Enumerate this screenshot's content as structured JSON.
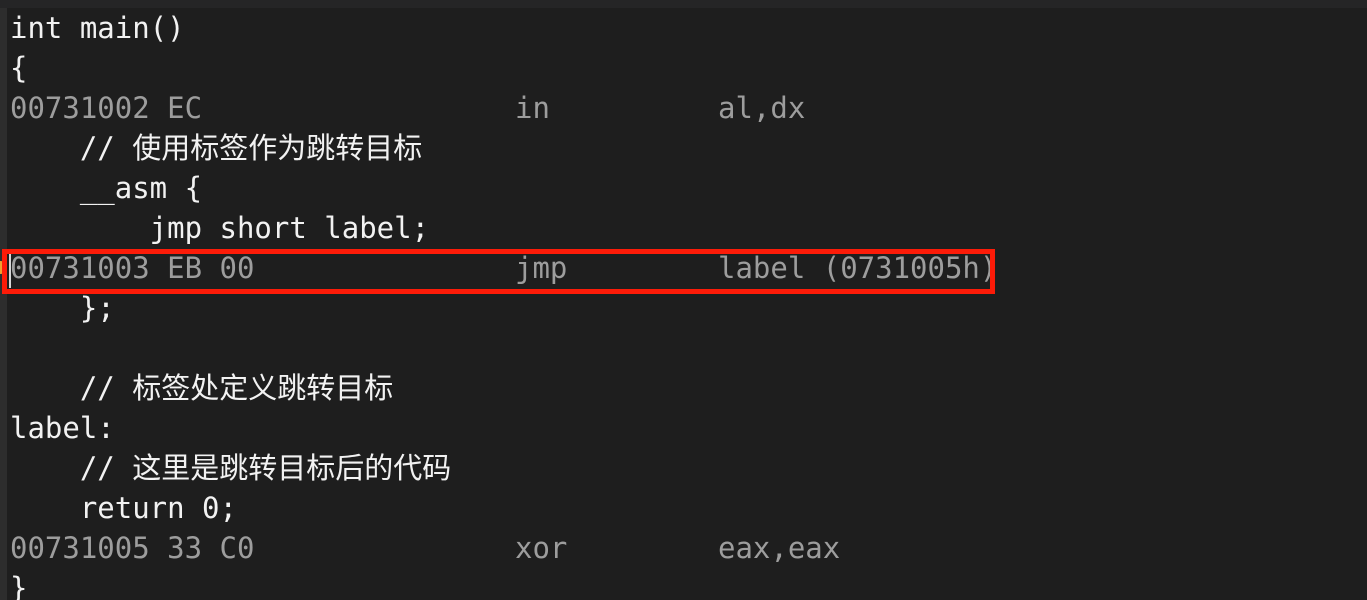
{
  "editor": {
    "background_color": "#1e1e1e",
    "gutter_color": "#2d2d2d",
    "source_text_color": "#f2f2f2",
    "disassembly_text_color": "#9d9d9d",
    "annotation_color": "#fc1b08",
    "marker_color": "#f0a030"
  },
  "lines": [
    {
      "kind": "source",
      "text": "int main()"
    },
    {
      "kind": "source",
      "text": "{"
    },
    {
      "kind": "asm",
      "address": "00731002",
      "bytes": "EC",
      "mnemonic": "in",
      "operands": "al,dx"
    },
    {
      "kind": "source",
      "text": "    // 使用标签作为跳转目标"
    },
    {
      "kind": "source",
      "text": "    __asm {"
    },
    {
      "kind": "source",
      "text": "        jmp short label;"
    },
    {
      "kind": "asm",
      "address": "00731003",
      "bytes": "EB 00",
      "mnemonic": "jmp",
      "operands": "label (0731005h)",
      "highlighted": true
    },
    {
      "kind": "source",
      "text": "    };"
    },
    {
      "kind": "source",
      "text": ""
    },
    {
      "kind": "source",
      "text": "    // 标签处定义跳转目标"
    },
    {
      "kind": "source",
      "text": "label:"
    },
    {
      "kind": "source",
      "text": "    // 这里是跳转目标后的代码"
    },
    {
      "kind": "source",
      "text": "    return 0;"
    },
    {
      "kind": "asm",
      "address": "00731005",
      "bytes": "33 C0",
      "mnemonic": "xor",
      "operands": "eax,eax"
    },
    {
      "kind": "source",
      "text": "}"
    }
  ],
  "annotation": {
    "label": "highlighted-jmp-instruction"
  }
}
